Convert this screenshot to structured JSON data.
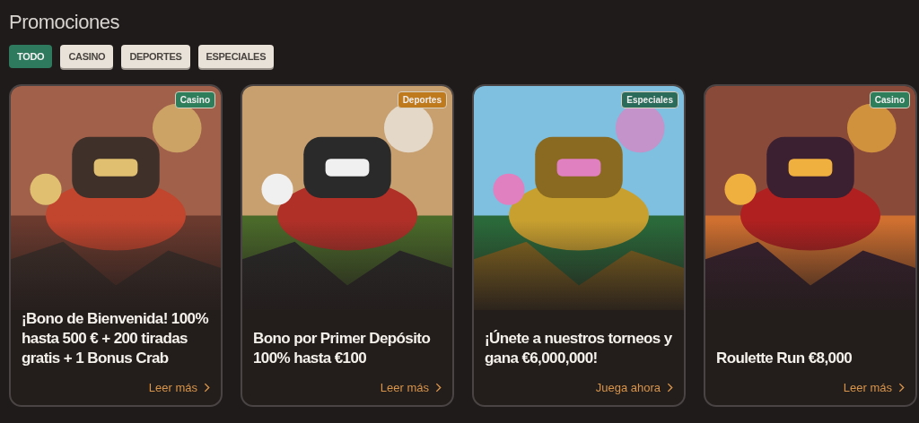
{
  "title": "Promociones",
  "filters": [
    {
      "label": "TODO",
      "selected": true
    },
    {
      "label": "CASINO",
      "selected": false
    },
    {
      "label": "DEPORTES",
      "selected": false
    },
    {
      "label": "ESPECIALES",
      "selected": false
    }
  ],
  "promotions": [
    {
      "badge": "Casino",
      "color": "#2e7d5b",
      "text": "¡Bono de Bienvenida! 100% hasta 500 € + 200 tiradas gratis + 1 Bonus Crab",
      "link": "Leer más"
    },
    {
      "badge": "Deportes",
      "color": "#c07a1e",
      "text": "Bono por Primer Depósito 100% hasta €100",
      "link": "Leer más"
    },
    {
      "badge": "Especiales",
      "color": "#2a6b5a",
      "text": "¡Únete a nuestros torneos y gana €6,000,000!",
      "link": "Juega ahora"
    },
    {
      "badge": "Casino",
      "color": "#2e7d5b",
      "text": "Roulette Run €8,000",
      "link": "Leer más"
    }
  ]
}
